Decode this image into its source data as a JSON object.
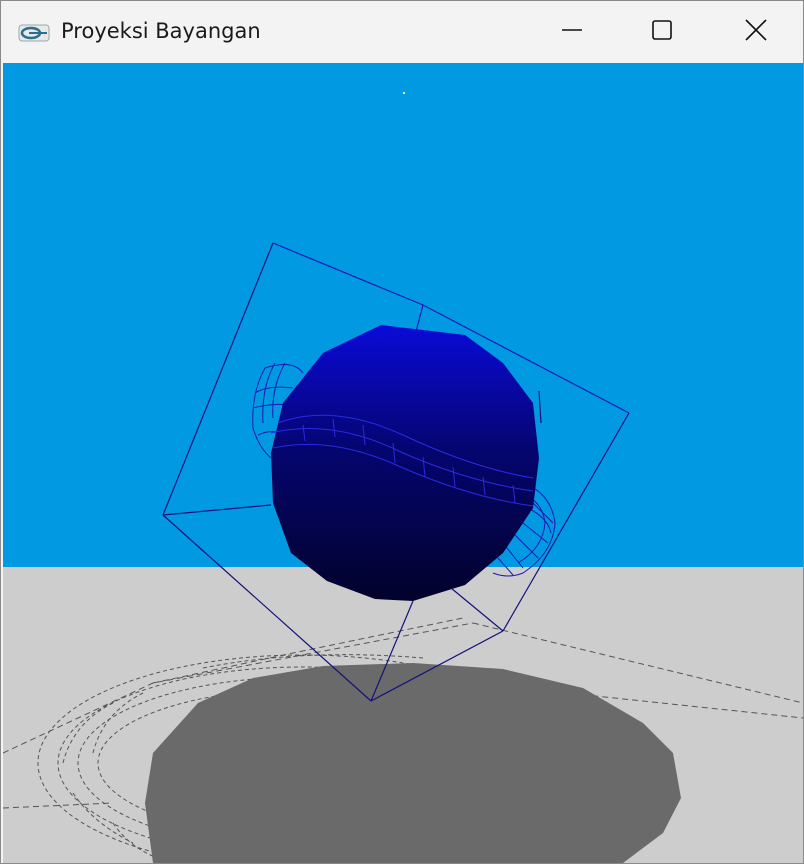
{
  "window": {
    "title": "Proyeksi Bayangan",
    "app_icon": "glut-app-icon",
    "controls": {
      "minimize_icon": "minimize-icon",
      "maximize_icon": "maximize-icon",
      "close_icon": "close-icon"
    }
  },
  "scene": {
    "sky_color": "#0099e2",
    "floor_color": "#cdcdcd",
    "shadow_color": "#6a6a6a",
    "object_color": "#0a0ad8",
    "wire_color": "#1a1ab0",
    "shadow_wire_color": "#555555"
  }
}
